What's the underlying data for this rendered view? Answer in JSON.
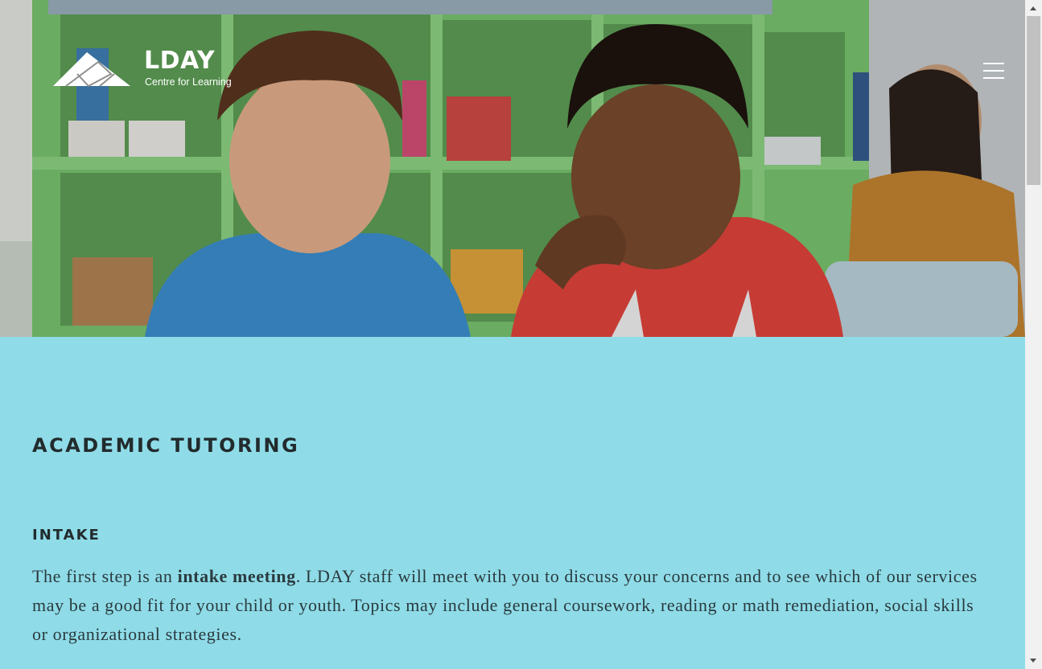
{
  "brand": {
    "logo_word": "LDAY",
    "logo_tagline": "Centre for Learning"
  },
  "header": {
    "menu_icon": "hamburger-menu-icon"
  },
  "hero": {
    "image_alt": "Two children reading together in a classroom"
  },
  "main": {
    "title": "ACADEMIC TUTORING",
    "sections": [
      {
        "heading": "INTAKE",
        "paragraph": {
          "before": "The first step is an ",
          "bold": "intake meeting",
          "after": ".  LDAY staff will meet with you to discuss your concerns and to see which of our services may be a good fit for your child or youth. Topics may include general coursework, reading or math remediation, social skills or organizational strategies."
        }
      }
    ]
  },
  "colors": {
    "content_background": "#8fdce8",
    "heading_text": "#222b2d",
    "body_text": "#2a3a3e"
  }
}
